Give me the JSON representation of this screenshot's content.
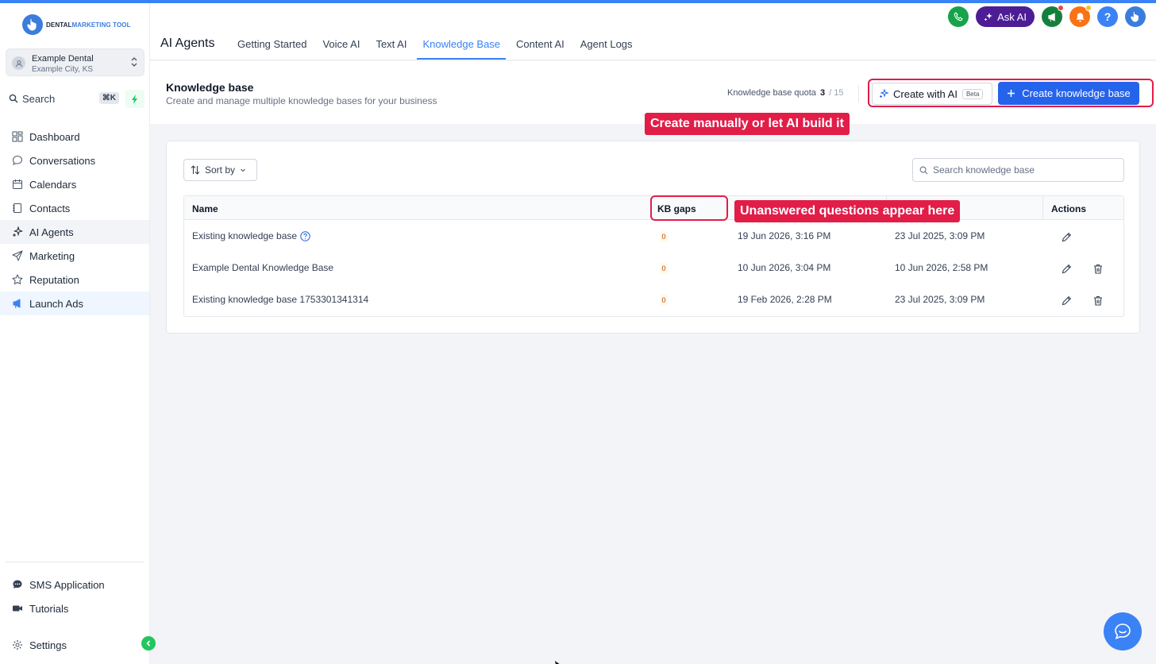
{
  "brand": {
    "logo_text_a": "DENTAL",
    "logo_text_b": "MARKETING TOOL",
    "accent": "#3b82f6"
  },
  "account": {
    "name": "Example Dental",
    "location": "Example City, KS"
  },
  "sidebar": {
    "search_label": "Search",
    "search_shortcut": "⌘K",
    "items": [
      {
        "label": "Dashboard",
        "icon": "dashboard-icon"
      },
      {
        "label": "Conversations",
        "icon": "chat-bubble-icon"
      },
      {
        "label": "Calendars",
        "icon": "calendar-icon"
      },
      {
        "label": "Contacts",
        "icon": "contacts-icon"
      },
      {
        "label": "AI Agents",
        "icon": "sparkle-icon"
      },
      {
        "label": "Marketing",
        "icon": "send-icon"
      },
      {
        "label": "Reputation",
        "icon": "star-icon"
      },
      {
        "label": "Launch Ads",
        "icon": "megaphone-icon"
      }
    ],
    "bottom_items": [
      {
        "label": "SMS Application",
        "icon": "sms-icon"
      },
      {
        "label": "Tutorials",
        "icon": "video-icon"
      }
    ],
    "settings_label": "Settings"
  },
  "header": {
    "title": "AI Agents",
    "tabs": [
      "Getting Started",
      "Voice AI",
      "Text AI",
      "Knowledge Base",
      "Content AI",
      "Agent Logs"
    ],
    "active_tab": "Knowledge Base",
    "ask_ai_label": "Ask AI"
  },
  "kb": {
    "title": "Knowledge base",
    "subtitle": "Create and manage multiple knowledge bases for your business",
    "quota_label": "Knowledge base quota",
    "quota_used": "3",
    "quota_total": "/ 15",
    "create_ai_label": "Create with AI",
    "beta_label": "Beta",
    "create_label": "Create knowledge base",
    "sort_label": "Sort by",
    "search_placeholder": "Search knowledge base",
    "columns": {
      "name": "Name",
      "gaps": "KB gaps",
      "actions": "Actions"
    },
    "rows": [
      {
        "name": "Existing knowledge base",
        "gaps": "0",
        "updated": "19 Jun 2026, 3:16 PM",
        "created": "23 Jul 2025, 3:09 PM",
        "deletable": false
      },
      {
        "name": "Example Dental Knowledge Base",
        "gaps": "0",
        "updated": "10 Jun 2026, 3:04 PM",
        "created": "10 Jun 2026, 2:58 PM",
        "deletable": true
      },
      {
        "name": "Existing knowledge base 1753301341314",
        "gaps": "0",
        "updated": "19 Feb 2026, 2:28 PM",
        "created": "23 Jul 2025, 3:09 PM",
        "deletable": true
      }
    ]
  },
  "annotations": {
    "create_callout": "Create manually or let AI build it",
    "gaps_callout": "Unanswered questions appear here",
    "color": "#e11d48"
  }
}
